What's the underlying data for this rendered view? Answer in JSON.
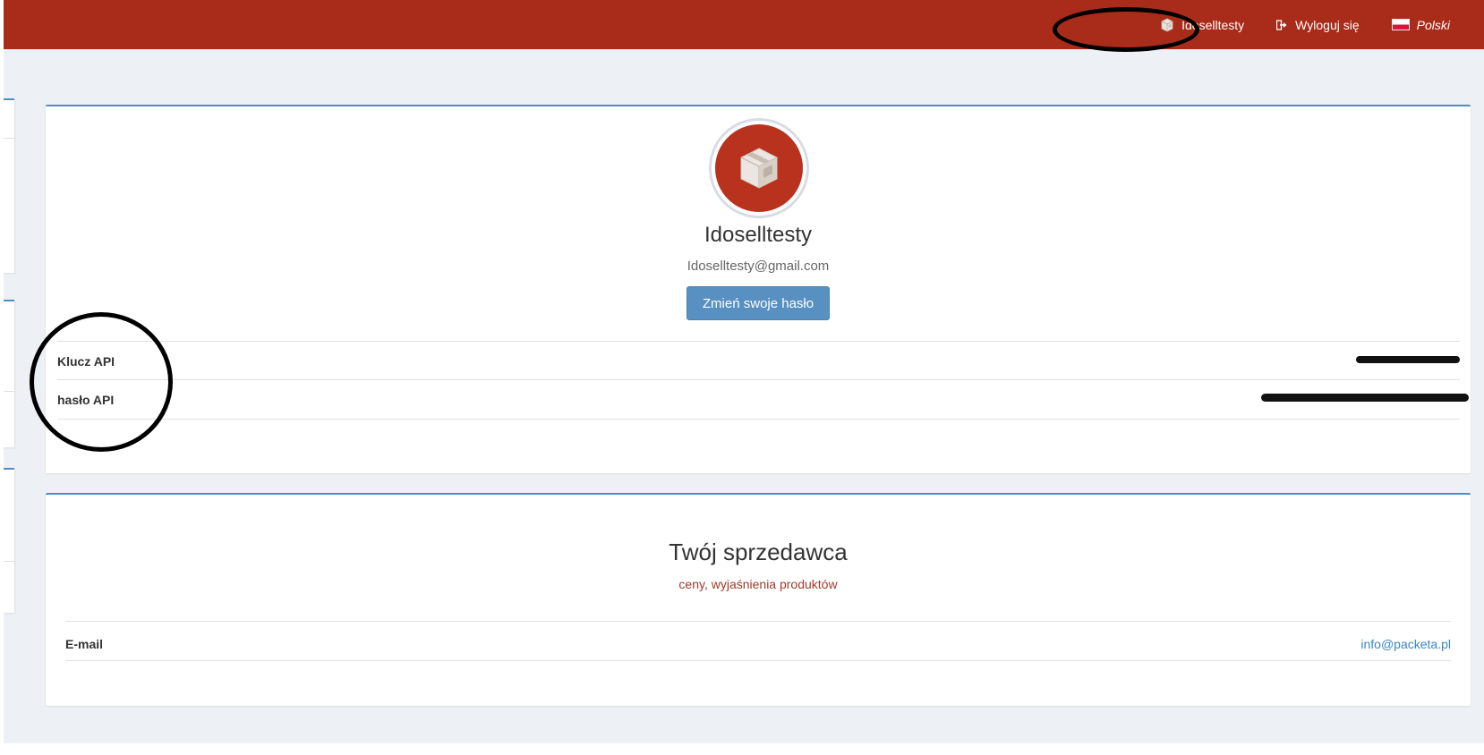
{
  "header": {
    "user_name": "Idoselltesty",
    "logout_label": "Wyloguj się",
    "language_label": "Polski",
    "background_color": "#a92b1a",
    "icons": {
      "user": "box-icon",
      "logout": "logout-icon",
      "language": "poland-flag-icon"
    }
  },
  "profile": {
    "name": "Idoselltesty",
    "email": "Idoselltesty@gmail.com",
    "change_password_label": "Zmień swoje hasło",
    "avatar_icon": "box-icon",
    "fields": [
      {
        "label": "Klucz API",
        "value_state": "redacted"
      },
      {
        "label": "hasło API",
        "value_state": "redacted"
      }
    ]
  },
  "seller": {
    "title": "Twój sprzedawca",
    "subtitle": "ceny, wyjaśnienia produktów",
    "email_label": "E-mail",
    "email_value": "info@packeta.pl"
  },
  "colors": {
    "accent": "#4f8fc0",
    "button": "#5890c1",
    "subtitle": "#a3392d",
    "link": "#3a87c2",
    "page_background": "#edf0f4"
  }
}
